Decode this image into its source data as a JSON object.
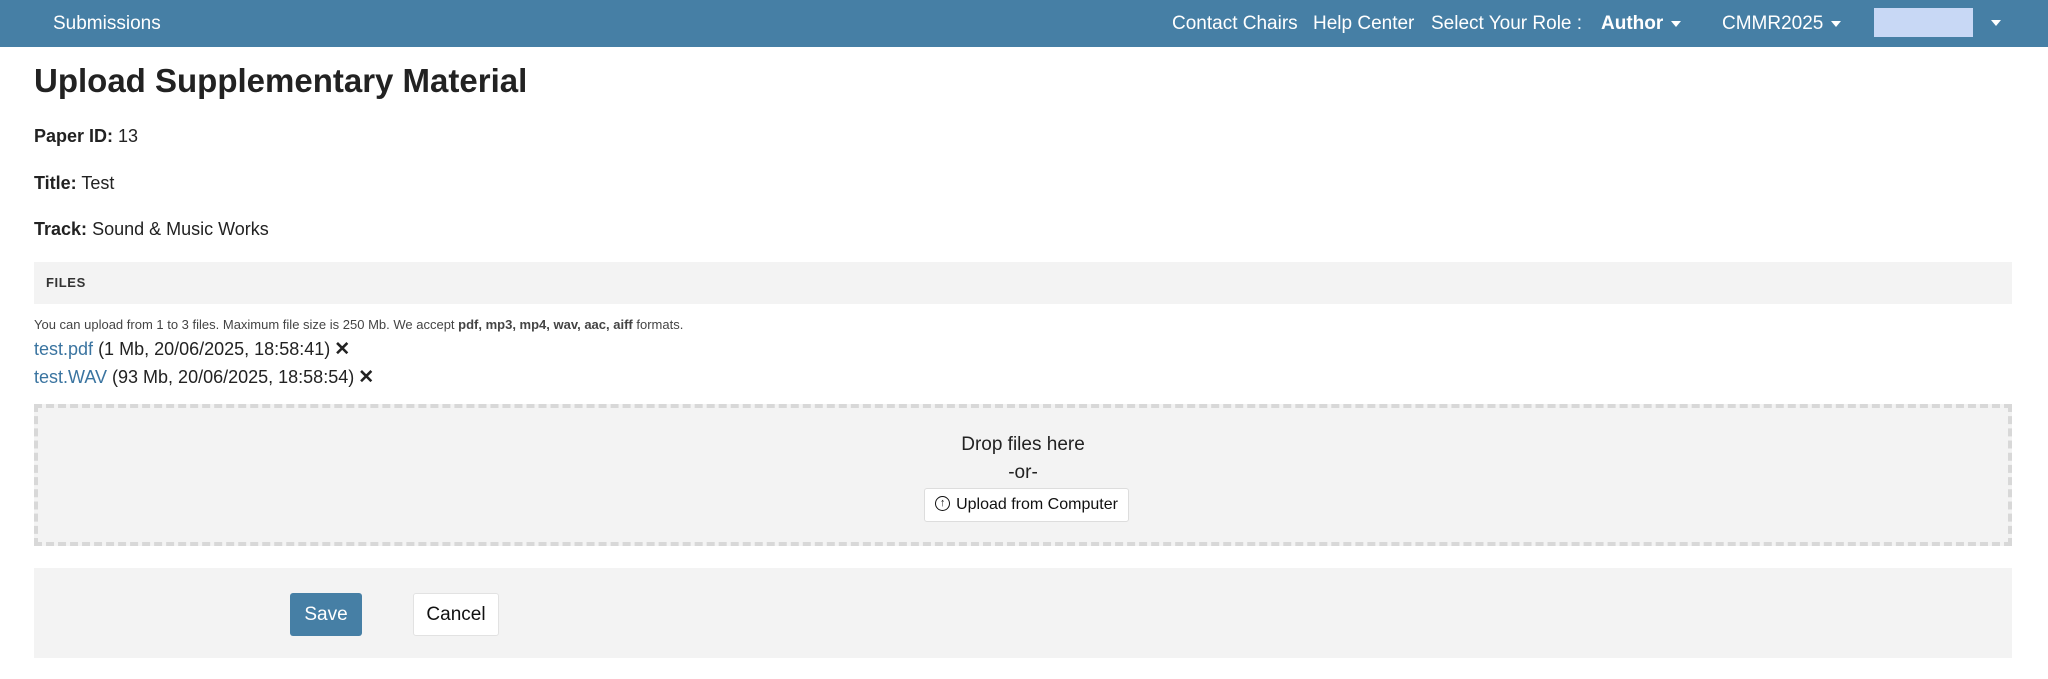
{
  "navbar": {
    "brand": "Submissions",
    "contact_chairs": "Contact Chairs",
    "help_center": "Help Center",
    "role_label": "Select Your Role :",
    "role_value": "Author",
    "conference": "CMMR2025"
  },
  "page": {
    "title": "Upload Supplementary Material",
    "paper_id_label": "Paper ID:",
    "paper_id": "13",
    "title_label": "Title:",
    "title_value": "Test",
    "track_label": "Track:",
    "track_value": "Sound & Music Works"
  },
  "files": {
    "section_label": "FILES",
    "help_prefix": "You can upload from 1 to 3 files. Maximum file size is 250 Mb. We accept ",
    "help_formats": "pdf, mp3, mp4, wav, aac, aiff",
    "help_suffix": " formats.",
    "items": [
      {
        "name": "test.pdf",
        "meta": "(1 Mb, 20/06/2025, 18:58:41)"
      },
      {
        "name": "test.WAV",
        "meta": "(93 Mb, 20/06/2025, 18:58:54)"
      }
    ],
    "remove_icon": "close-icon"
  },
  "dropzone": {
    "title": "Drop files here",
    "or": "-or-",
    "upload_label": "Upload from Computer",
    "upload_icon": "upload-circle-icon"
  },
  "actions": {
    "save_label": "Save",
    "cancel_label": "Cancel"
  },
  "colors": {
    "primary": "#467fa5",
    "link": "#3a74a0",
    "panel": "#f3f3f3"
  }
}
